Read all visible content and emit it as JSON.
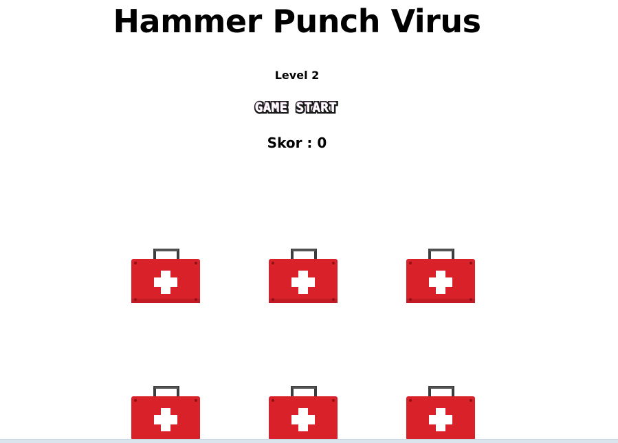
{
  "game": {
    "title": "Hammer Punch Virus",
    "level": "Level 2",
    "start_button_label": "GAME START",
    "score_label": "Skor",
    "score_separator": " : ",
    "score_value": "0"
  },
  "board": {
    "holes": [
      {
        "icon": "first-aid-kit-icon"
      },
      {
        "icon": "first-aid-kit-icon"
      },
      {
        "icon": "first-aid-kit-icon"
      },
      {
        "icon": "first-aid-kit-icon"
      },
      {
        "icon": "first-aid-kit-icon"
      },
      {
        "icon": "first-aid-kit-icon"
      }
    ]
  },
  "colors": {
    "kit_red": "#d9212a",
    "kit_cross": "#ffffff",
    "kit_handle": "#3d3d3d",
    "start_button_text": "#ffffff",
    "start_button_shadow": "#1a1a1a"
  }
}
